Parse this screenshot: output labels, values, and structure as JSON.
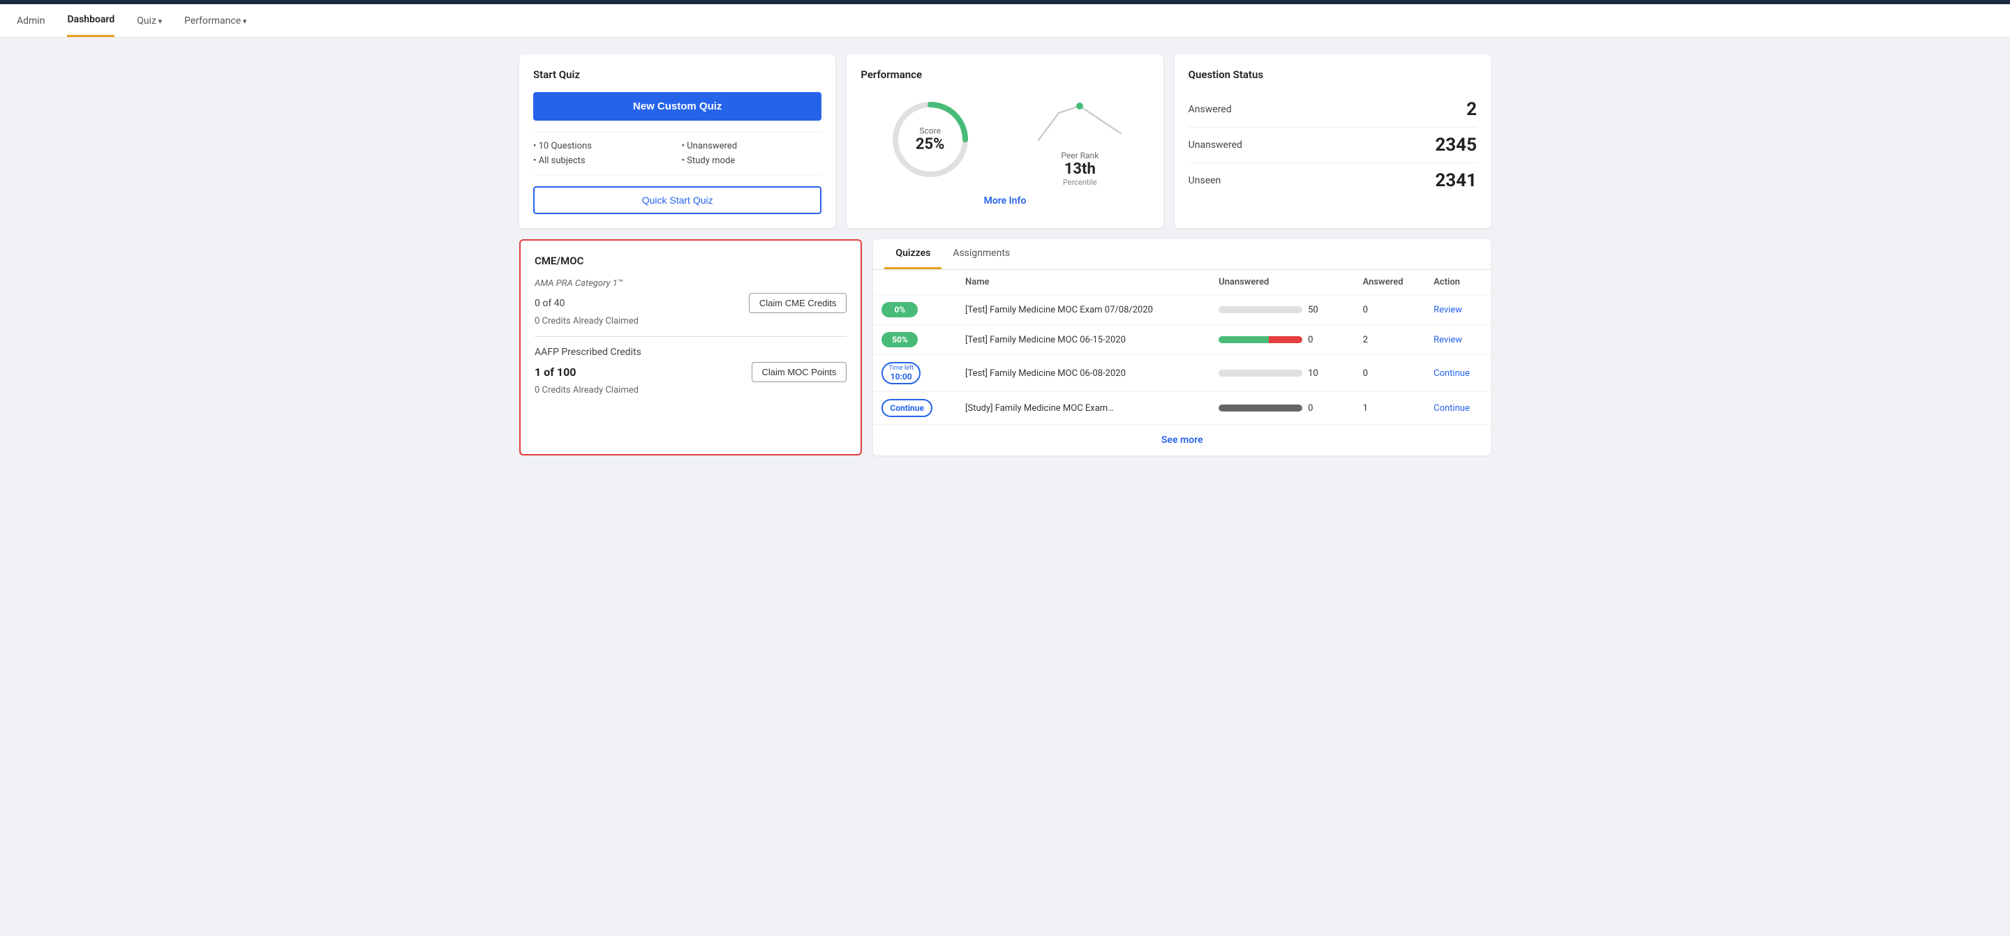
{
  "topbar": {
    "nav_items": [
      {
        "label": "Admin",
        "active": false,
        "arrow": false
      },
      {
        "label": "Dashboard",
        "active": true,
        "arrow": false
      },
      {
        "label": "Quiz",
        "active": false,
        "arrow": true
      },
      {
        "label": "Performance",
        "active": false,
        "arrow": true
      }
    ]
  },
  "start_quiz": {
    "section_title": "Start Quiz",
    "new_quiz_button": "New Custom Quiz",
    "options": [
      "10 Questions",
      "All subjects",
      "Unanswered",
      "Study mode"
    ],
    "quick_start_button": "Quick Start Quiz"
  },
  "performance": {
    "section_title": "Performance",
    "score_label": "Score",
    "score_value": "25%",
    "peer_rank_label": "Peer Rank",
    "peer_rank_value": "13th",
    "peer_rank_sub": "Percentile",
    "more_info": "More Info"
  },
  "question_status": {
    "section_title": "Question Status",
    "rows": [
      {
        "label": "Answered",
        "value": "2"
      },
      {
        "label": "Unanswered",
        "value": "2345"
      },
      {
        "label": "Unseen",
        "value": "2341"
      }
    ]
  },
  "cme": {
    "section_title": "CME/MOC",
    "category1_label": "AMA PRA Category 1™",
    "cme_count": "0 of 40",
    "claim_cme_button": "Claim CME Credits",
    "cme_claimed": "0 Credits Already Claimed",
    "aafp_label": "AAFP Prescribed Credits",
    "moc_count": "1 of 100",
    "claim_moc_button": "Claim MOC Points",
    "moc_claimed": "0 Credits Already Claimed"
  },
  "quizzes": {
    "tabs": [
      "Quizzes",
      "Assignments"
    ],
    "active_tab": "Quizzes",
    "table_headers": [
      "",
      "Name",
      "Unanswered",
      "Answered",
      "Action"
    ],
    "rows": [
      {
        "badge_type": "green_filled",
        "badge_label": "0%",
        "name": "[Test] Family Medicine MOC Exam 07/08/2020",
        "progress_type": "empty",
        "unanswered": "50",
        "answered": "0",
        "action": "Review"
      },
      {
        "badge_type": "green_filled",
        "badge_label": "50%",
        "name": "[Test] Family Medicine MOC 06-15-2020",
        "progress_type": "split",
        "unanswered": "0",
        "answered": "2",
        "action": "Review"
      },
      {
        "badge_type": "time",
        "badge_label": "Time left",
        "badge_time": "10:00",
        "name": "[Test] Family Medicine MOC 06-08-2020",
        "progress_type": "empty",
        "unanswered": "10",
        "answered": "0",
        "action": "Continue"
      },
      {
        "badge_type": "outline_blue",
        "badge_label": "Continue",
        "name": "[Study] Family Medicine MOC Exam…",
        "progress_type": "dark",
        "unanswered": "0",
        "answered": "1",
        "action": "Continue"
      }
    ],
    "see_more": "See more"
  }
}
